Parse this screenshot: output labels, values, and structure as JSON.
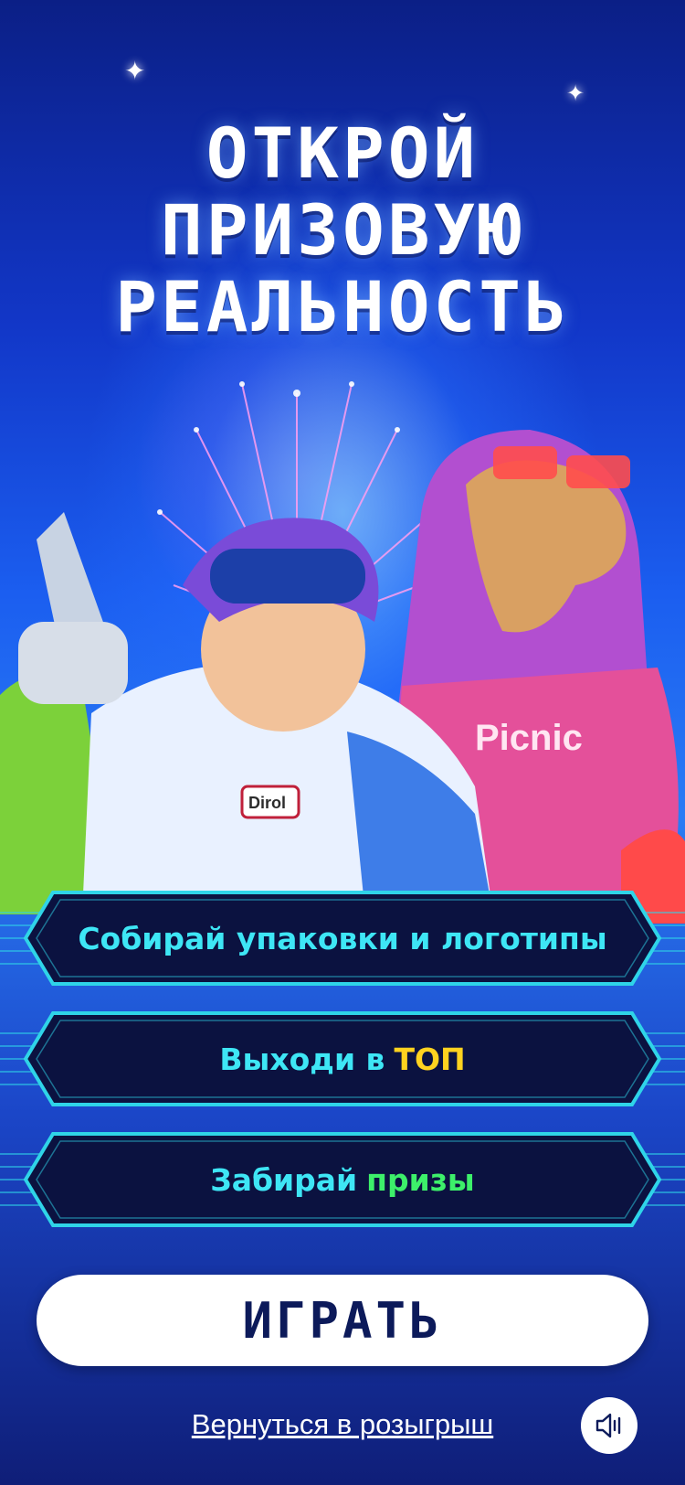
{
  "hero": {
    "title_lines": [
      "ОТКРОЙ",
      "ПРИЗОВУЮ",
      "РЕАЛЬНОСТЬ"
    ]
  },
  "steps": [
    {
      "text": "Собирай упаковки и логотипы",
      "highlight": ""
    },
    {
      "text": "Выходи в",
      "highlight": "ТОП",
      "highlight_color": "#ffd21f"
    },
    {
      "text": "Забирай",
      "highlight": "призы",
      "highlight_color": "#3df06a"
    }
  ],
  "play_button": {
    "label": "ИГРАТЬ"
  },
  "back_link": {
    "label": "Вернуться в розыгрыш"
  },
  "sound_button": {
    "icon": "speaker-icon"
  },
  "brands": {
    "boy_badge": "Dirol",
    "camel_hoodie": "Picnic"
  },
  "colors": {
    "accent_cyan": "#3ee6f5",
    "panel_dark": "#0b1240",
    "button_text": "#0c1a5a"
  }
}
